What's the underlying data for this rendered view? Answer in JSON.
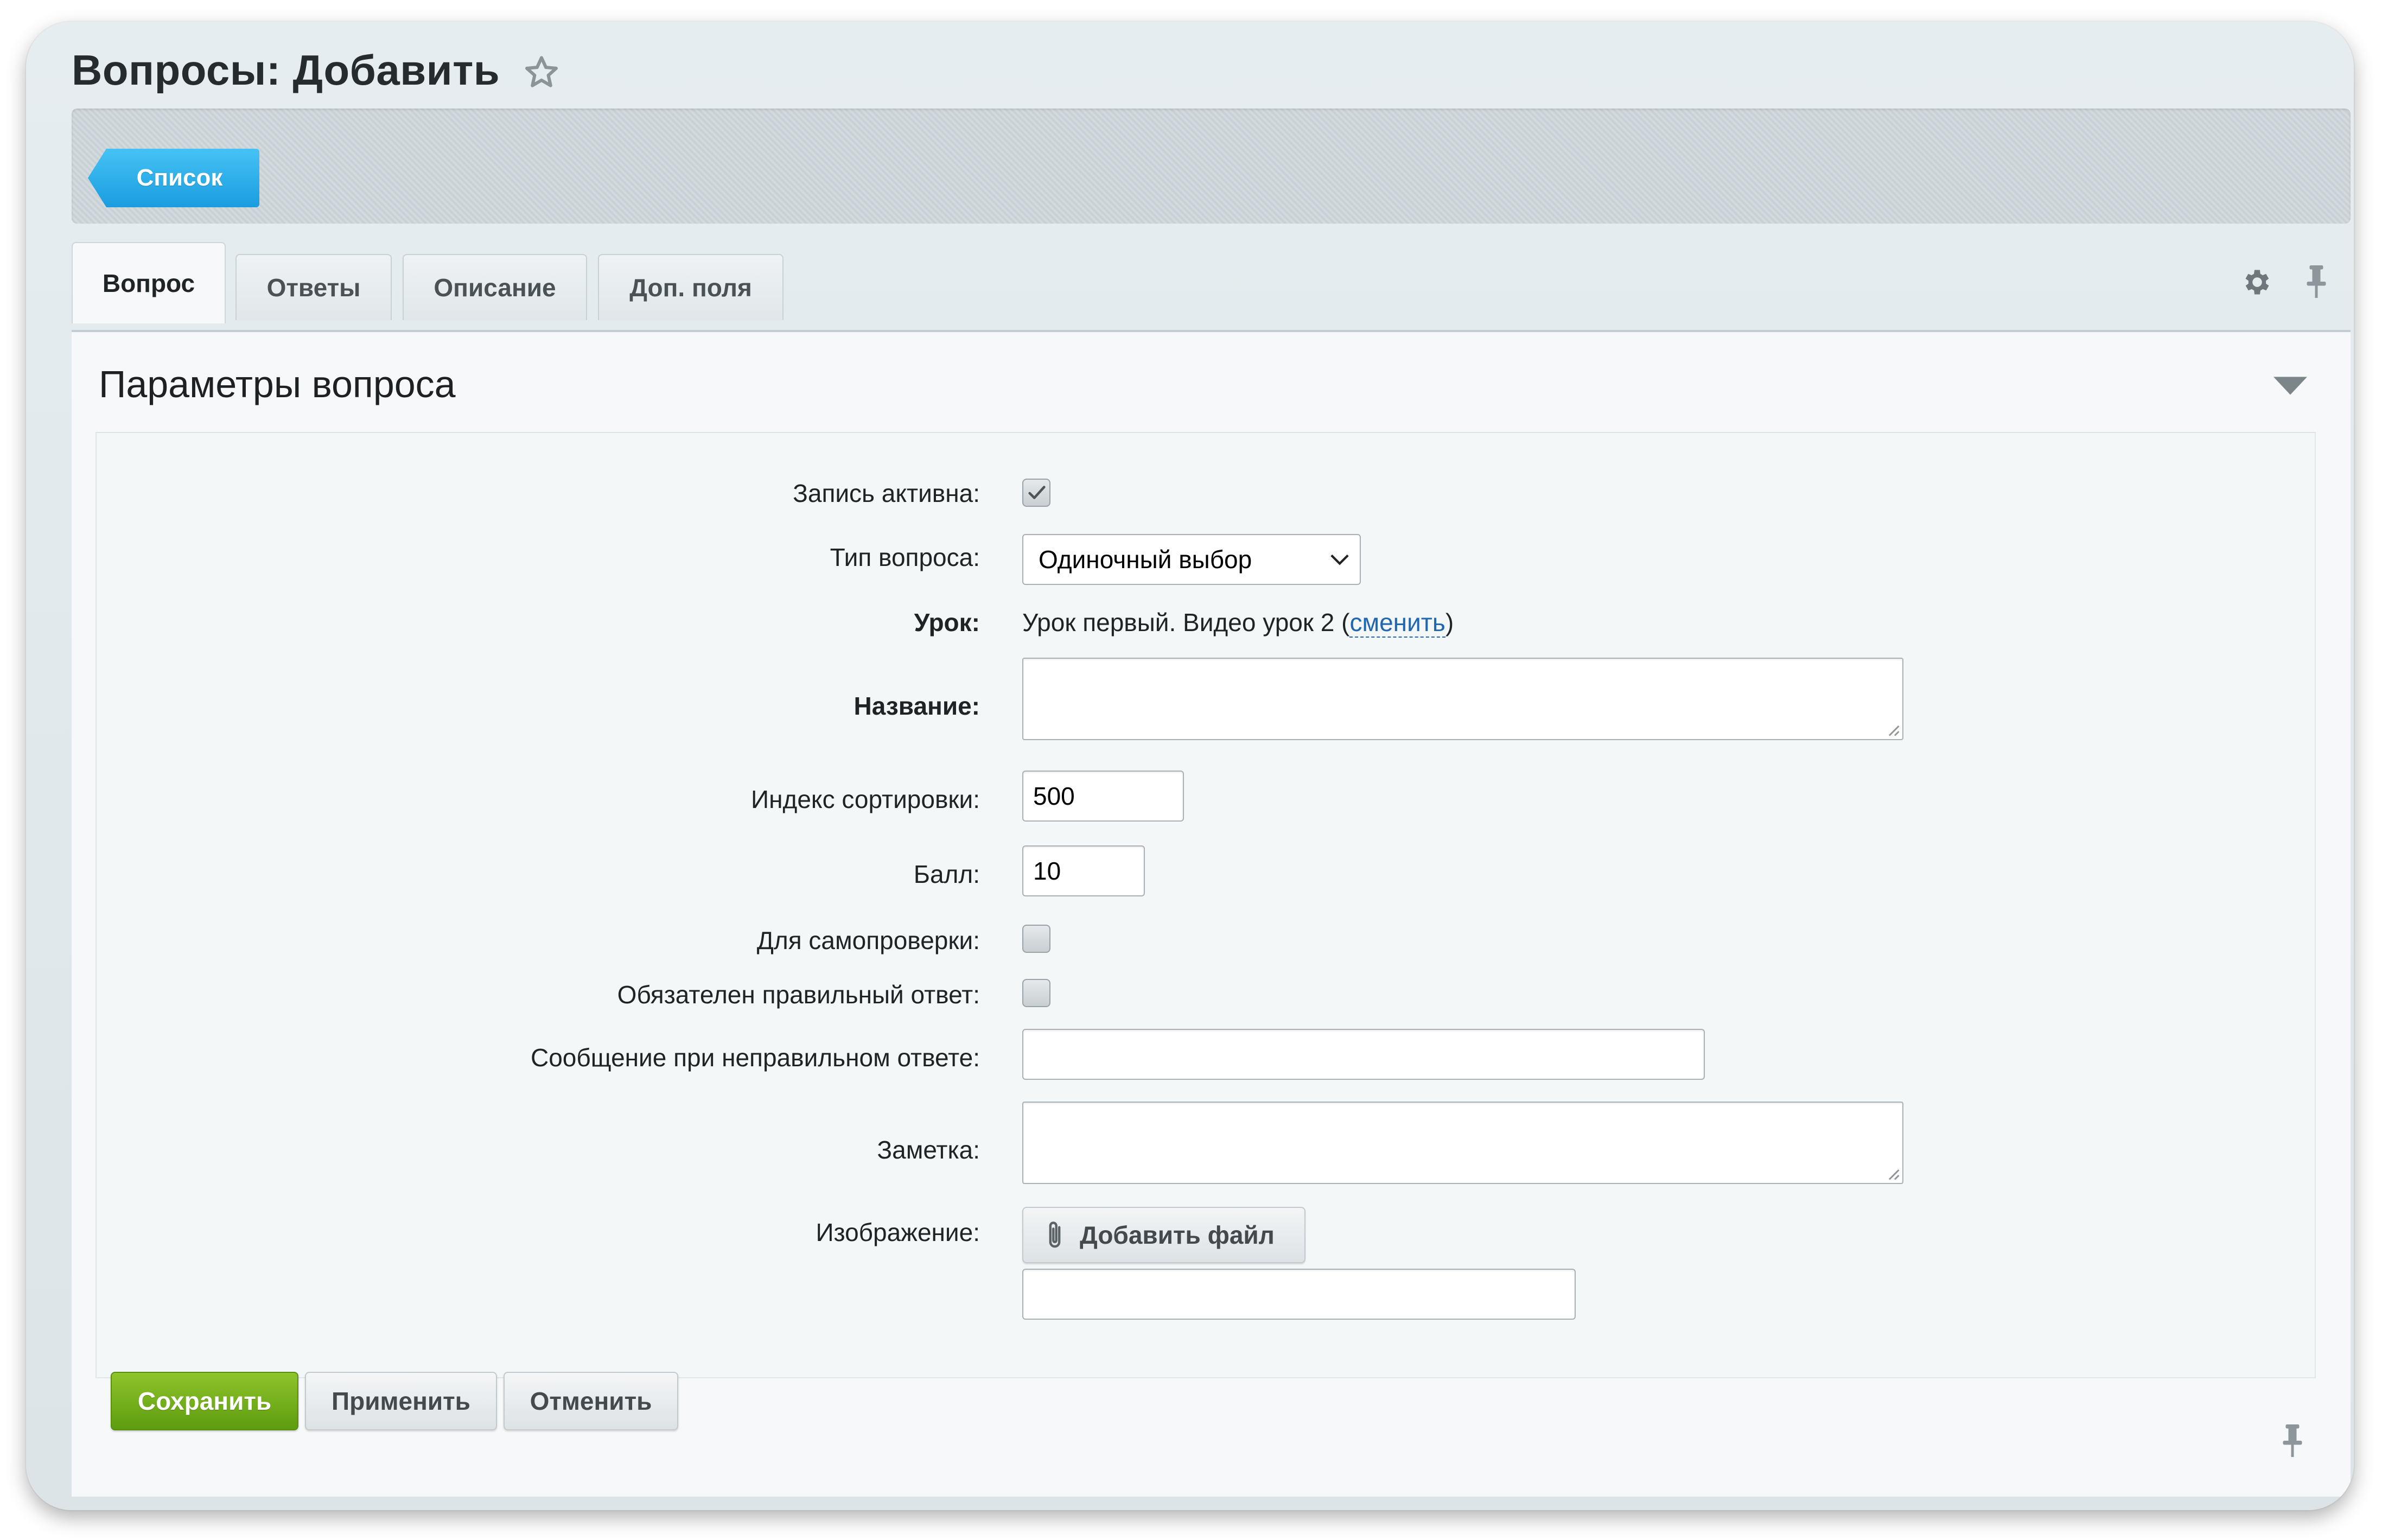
{
  "header": {
    "title": "Вопросы: Добавить",
    "favorite_icon": "star-icon"
  },
  "toolbar": {
    "list_button": "Список"
  },
  "tabs": [
    {
      "label": "Вопрос",
      "active": true
    },
    {
      "label": "Ответы",
      "active": false
    },
    {
      "label": "Описание",
      "active": false
    },
    {
      "label": "Доп. поля",
      "active": false
    }
  ],
  "section": {
    "title": "Параметры вопроса"
  },
  "form": {
    "active": {
      "label": "Запись активна:",
      "checked": true
    },
    "question_type": {
      "label": "Тип вопроса:",
      "value": "Одиночный выбор"
    },
    "lesson": {
      "label": "Урок:",
      "value": "Урок первый. Видео урок 2 (",
      "link": "сменить",
      "close": ")"
    },
    "name": {
      "label": "Название:",
      "value": ""
    },
    "sort_index": {
      "label": "Индекс сортировки:",
      "value": "500"
    },
    "score": {
      "label": "Балл:",
      "value": "10"
    },
    "self_check": {
      "label": "Для самопроверки:",
      "checked": false
    },
    "correct_required": {
      "label": "Обязателен правильный ответ:",
      "checked": false
    },
    "wrong_message": {
      "label": "Сообщение при неправильном ответе:",
      "value": ""
    },
    "note": {
      "label": "Заметка:",
      "value": ""
    },
    "image": {
      "label": "Изображение:",
      "button": "Добавить файл",
      "value": ""
    }
  },
  "footer": {
    "save": "Сохранить",
    "apply": "Применить",
    "cancel": "Отменить"
  },
  "colors": {
    "accent_blue": "#1a9ddf",
    "save_green": "#5d9c10",
    "link": "#2067b0"
  }
}
